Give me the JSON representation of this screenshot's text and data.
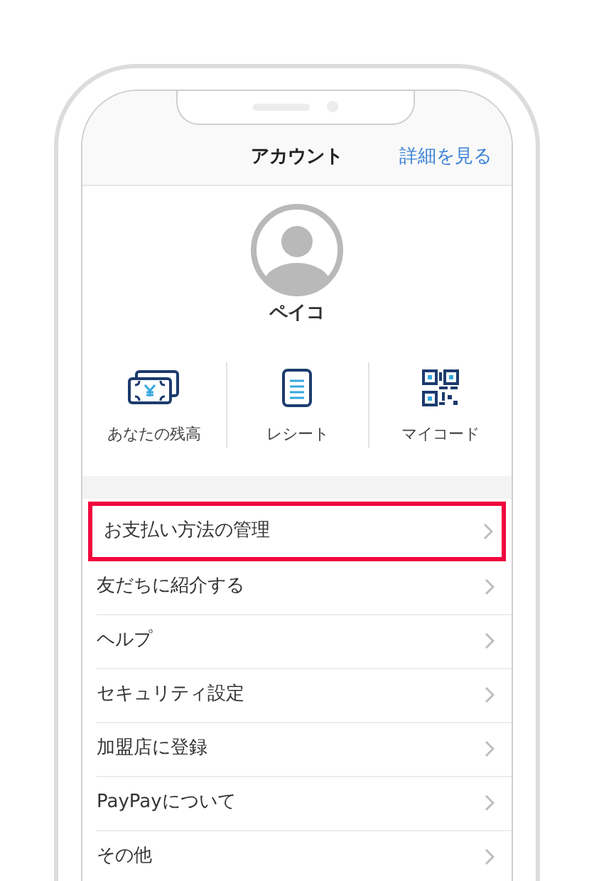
{
  "header": {
    "title": "アカウント",
    "action": "詳細を見る"
  },
  "profile": {
    "name": "ペイコ"
  },
  "shortcuts": [
    {
      "kind": "balance",
      "label": "あなたの残高"
    },
    {
      "kind": "receipt",
      "label": "レシート"
    },
    {
      "kind": "qr",
      "label": "マイコード"
    }
  ],
  "menu": [
    {
      "label": "お支払い方法の管理",
      "highlighted": true
    },
    {
      "label": "友だちに紹介する",
      "highlighted": false
    },
    {
      "label": "ヘルプ",
      "highlighted": false
    },
    {
      "label": "セキュリティ設定",
      "highlighted": false
    },
    {
      "label": "加盟店に登録",
      "highlighted": false
    },
    {
      "label": "PayPayについて",
      "highlighted": false
    },
    {
      "label": "その他",
      "highlighted": false
    }
  ]
}
